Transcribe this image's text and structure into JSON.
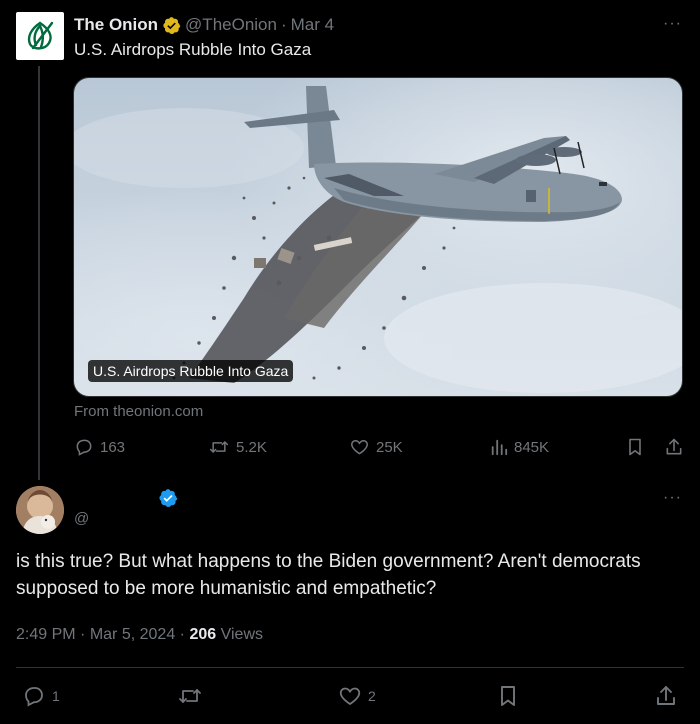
{
  "original_tweet": {
    "author_name": "The Onion",
    "author_handle": "@TheOnion",
    "separator": "·",
    "date": "Mar 4",
    "text": "U.S. Airdrops Rubble Into Gaza",
    "media_caption": "U.S. Airdrops Rubble Into Gaza",
    "link_source": "From theonion.com",
    "stats": {
      "replies": "163",
      "reposts": "5.2K",
      "likes": "25K",
      "views": "845K"
    },
    "more_label": "···"
  },
  "reply": {
    "author_name": "",
    "author_handle": "@",
    "text": "is this true? But what happens to the Biden government? Aren't democrats supposed to be more humanistic and empathetic?",
    "time": "2:49 PM",
    "date": "Mar 5, 2024",
    "separator": "·",
    "views_count": "206",
    "views_label": "Views",
    "stats": {
      "replies": "1",
      "likes": "2"
    },
    "more_label": "···"
  },
  "icons": {
    "brand_logo": "onion-logo-icon",
    "affiliate_badge": "gold-badge-icon",
    "verified_badge": "blue-verified-icon",
    "reply": "reply-icon",
    "repost": "repost-icon",
    "like": "heart-icon",
    "views": "views-icon",
    "bookmark": "bookmark-icon",
    "share": "share-icon"
  },
  "colors": {
    "background": "#000000",
    "text_primary": "#e7e9ea",
    "text_secondary": "#71767b",
    "verified_blue": "#1d9bf0",
    "gold_badge": "#e2b719",
    "onion_green": "#006b3f"
  }
}
